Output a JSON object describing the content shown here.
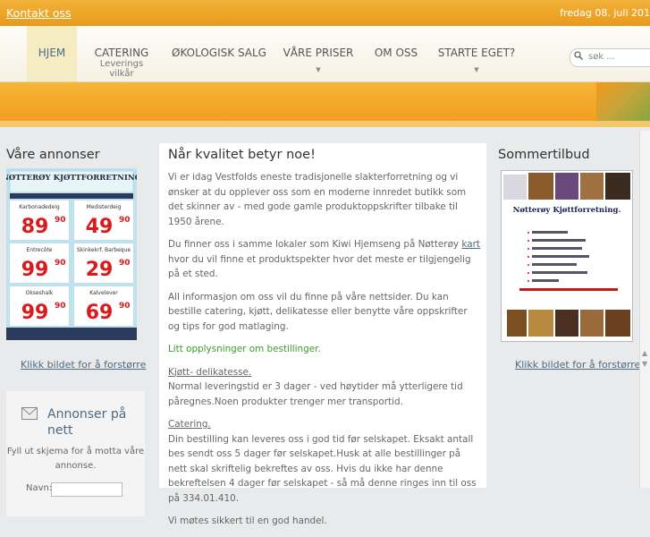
{
  "topbar": {
    "contact": "Kontakt oss",
    "date": "fredag 08. juli 201"
  },
  "nav": {
    "items": [
      {
        "label": "HJEM",
        "sub": ""
      },
      {
        "label": "CATERING",
        "sub": "Leverings vilkår"
      },
      {
        "label": "ØKOLOGISK SALG",
        "sub": ""
      },
      {
        "label": "VÅRE PRISER",
        "sub": ""
      },
      {
        "label": "OM OSS",
        "sub": ""
      },
      {
        "label": "STARTE EGET?",
        "sub": ""
      }
    ],
    "search_placeholder": "søk ..."
  },
  "left": {
    "title": "Våre annonser",
    "enlarge": "Klikk bildet for å forstørre",
    "ad": {
      "header": "NØTTERØY KJØTTFORRETNING",
      "offers": [
        {
          "name": "Karbonadedeig",
          "price": "89",
          "cents": "90"
        },
        {
          "name": "Medisterdeig",
          "price": "49",
          "cents": "90"
        },
        {
          "name": "Entrecôte",
          "price": "99",
          "cents": "90"
        },
        {
          "name": "Skinkekrf. Barbeque",
          "price": "29",
          "cents": "90"
        },
        {
          "name": "Okseshalk",
          "price": "99",
          "cents": "90"
        },
        {
          "name": "Kalvelever",
          "price": "69",
          "cents": "90"
        }
      ]
    },
    "annonser_box": {
      "title": "Annonser på nett",
      "text": "Fyll ut skjema for å motta våre annonse.",
      "name_label": "Navn:"
    }
  },
  "main": {
    "title": "Når kvalitet betyr noe!",
    "p1": "Vi er idag Vestfolds eneste tradisjonelle slakterforretning og vi ønsker at du opplever oss som en moderne innredet butikk som det skinner av - med gode gamle produktoppskrifter tilbake til 1950 årene.",
    "p2_before": "Du finner oss i samme lokaler som Kiwi Hjemseng på Nøtterøy ",
    "p2_link": "kart",
    "p2_after": " hvor du vil finne et produktspekter hvor det meste er tilgjengelig på et sted.",
    "p3": "All informasjon om oss vil du finne på våre nettsider. Du kan bestille catering, kjøtt, delikatesse eller benytte våre oppskrifter og tips for god matlaging.",
    "p4": "Litt opplysninger om bestillinger.",
    "h_kjott": "Kjøtt- delikatesse.",
    "p5": "Normal leveringstid er 3 dager - ved høytider må ytterligere tid påregnes.Noen produkter trenger mer transportid.",
    "h_catering": "Catering.",
    "p6": "Din bestilling kan leveres oss i god tid før selskapet. Eksakt antall bes sendt oss 5 dager før selskapet.Husk at alle bestillinger på nett skal skriftelig bekreftes av oss. Hvis du ikke har denne bekreftelsen 4 dager før selskapet - så må denne ringes inn til oss på 334.01.410.",
    "p7": "Vi møtes sikkert til en god handel."
  },
  "right": {
    "title": "Sommertilbud",
    "enlarge": "Klikk bildet for å forstørre",
    "flyer_title": "Nøtterøy Kjøttforretning."
  },
  "colors": {
    "orange": "#f29a1a",
    "link": "#4d6a80",
    "green": "#3d9b2e",
    "price_red": "#d9191c"
  }
}
